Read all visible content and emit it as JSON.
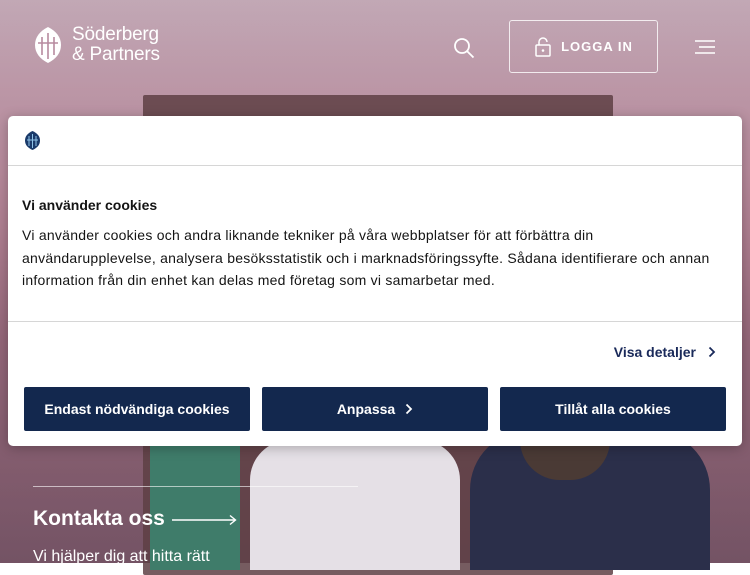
{
  "header": {
    "logo_line1": "Söderberg",
    "logo_line2": "& Partners",
    "login_label": "LOGGA IN"
  },
  "hero": {
    "contact_title": "Kontakta oss",
    "contact_sub": "Vi hjälper dig att hitta rätt"
  },
  "cookie_dialog": {
    "title": "Vi använder cookies",
    "text": "Vi använder cookies och andra liknande tekniker på våra webbplatser för att förbättra din användarupplevelse, analysera besöksstatistik och i marknadsföringssyfte. Sådana identifierare och annan information från din enhet kan delas med företag som vi samarbetar med.",
    "details_label": "Visa detaljer",
    "buttons": {
      "necessary": "Endast nödvändiga cookies",
      "customize": "Anpassa",
      "allow_all": "Tillåt alla cookies"
    }
  },
  "colors": {
    "button_bg": "#13284e",
    "link_color": "#1a2a5a"
  },
  "icons": [
    "lion-logo-icon",
    "search-icon",
    "lock-icon",
    "menu-icon",
    "arrow-right-icon",
    "chevron-right-icon"
  ]
}
